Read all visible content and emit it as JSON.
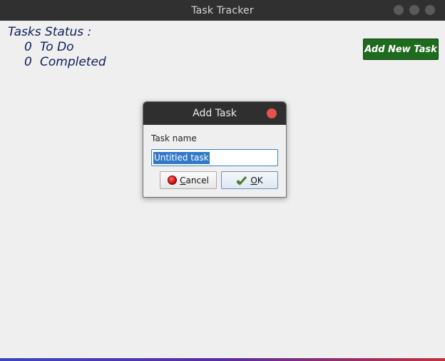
{
  "window": {
    "title": "Task Tracker"
  },
  "status": {
    "heading": "Tasks Status :",
    "todo_count": "0",
    "todo_label": "To Do",
    "completed_count": "0",
    "completed_label": "Completed"
  },
  "toolbar": {
    "add_new_task_label": "Add New Task"
  },
  "dialog": {
    "title": "Add Task",
    "field_label": "Task name",
    "task_name_value": "Untitled task",
    "cancel_mnemonic": "C",
    "cancel_rest": "ancel",
    "ok_mnemonic": "O",
    "ok_rest": "K"
  },
  "colors": {
    "status_text": "#0f1d5a",
    "add_button_bg": "#1e6a1e",
    "dialog_close": "#e5534b",
    "selection": "#3378c8"
  },
  "icons": {
    "cancel": "stop-icon",
    "ok": "check-icon"
  }
}
